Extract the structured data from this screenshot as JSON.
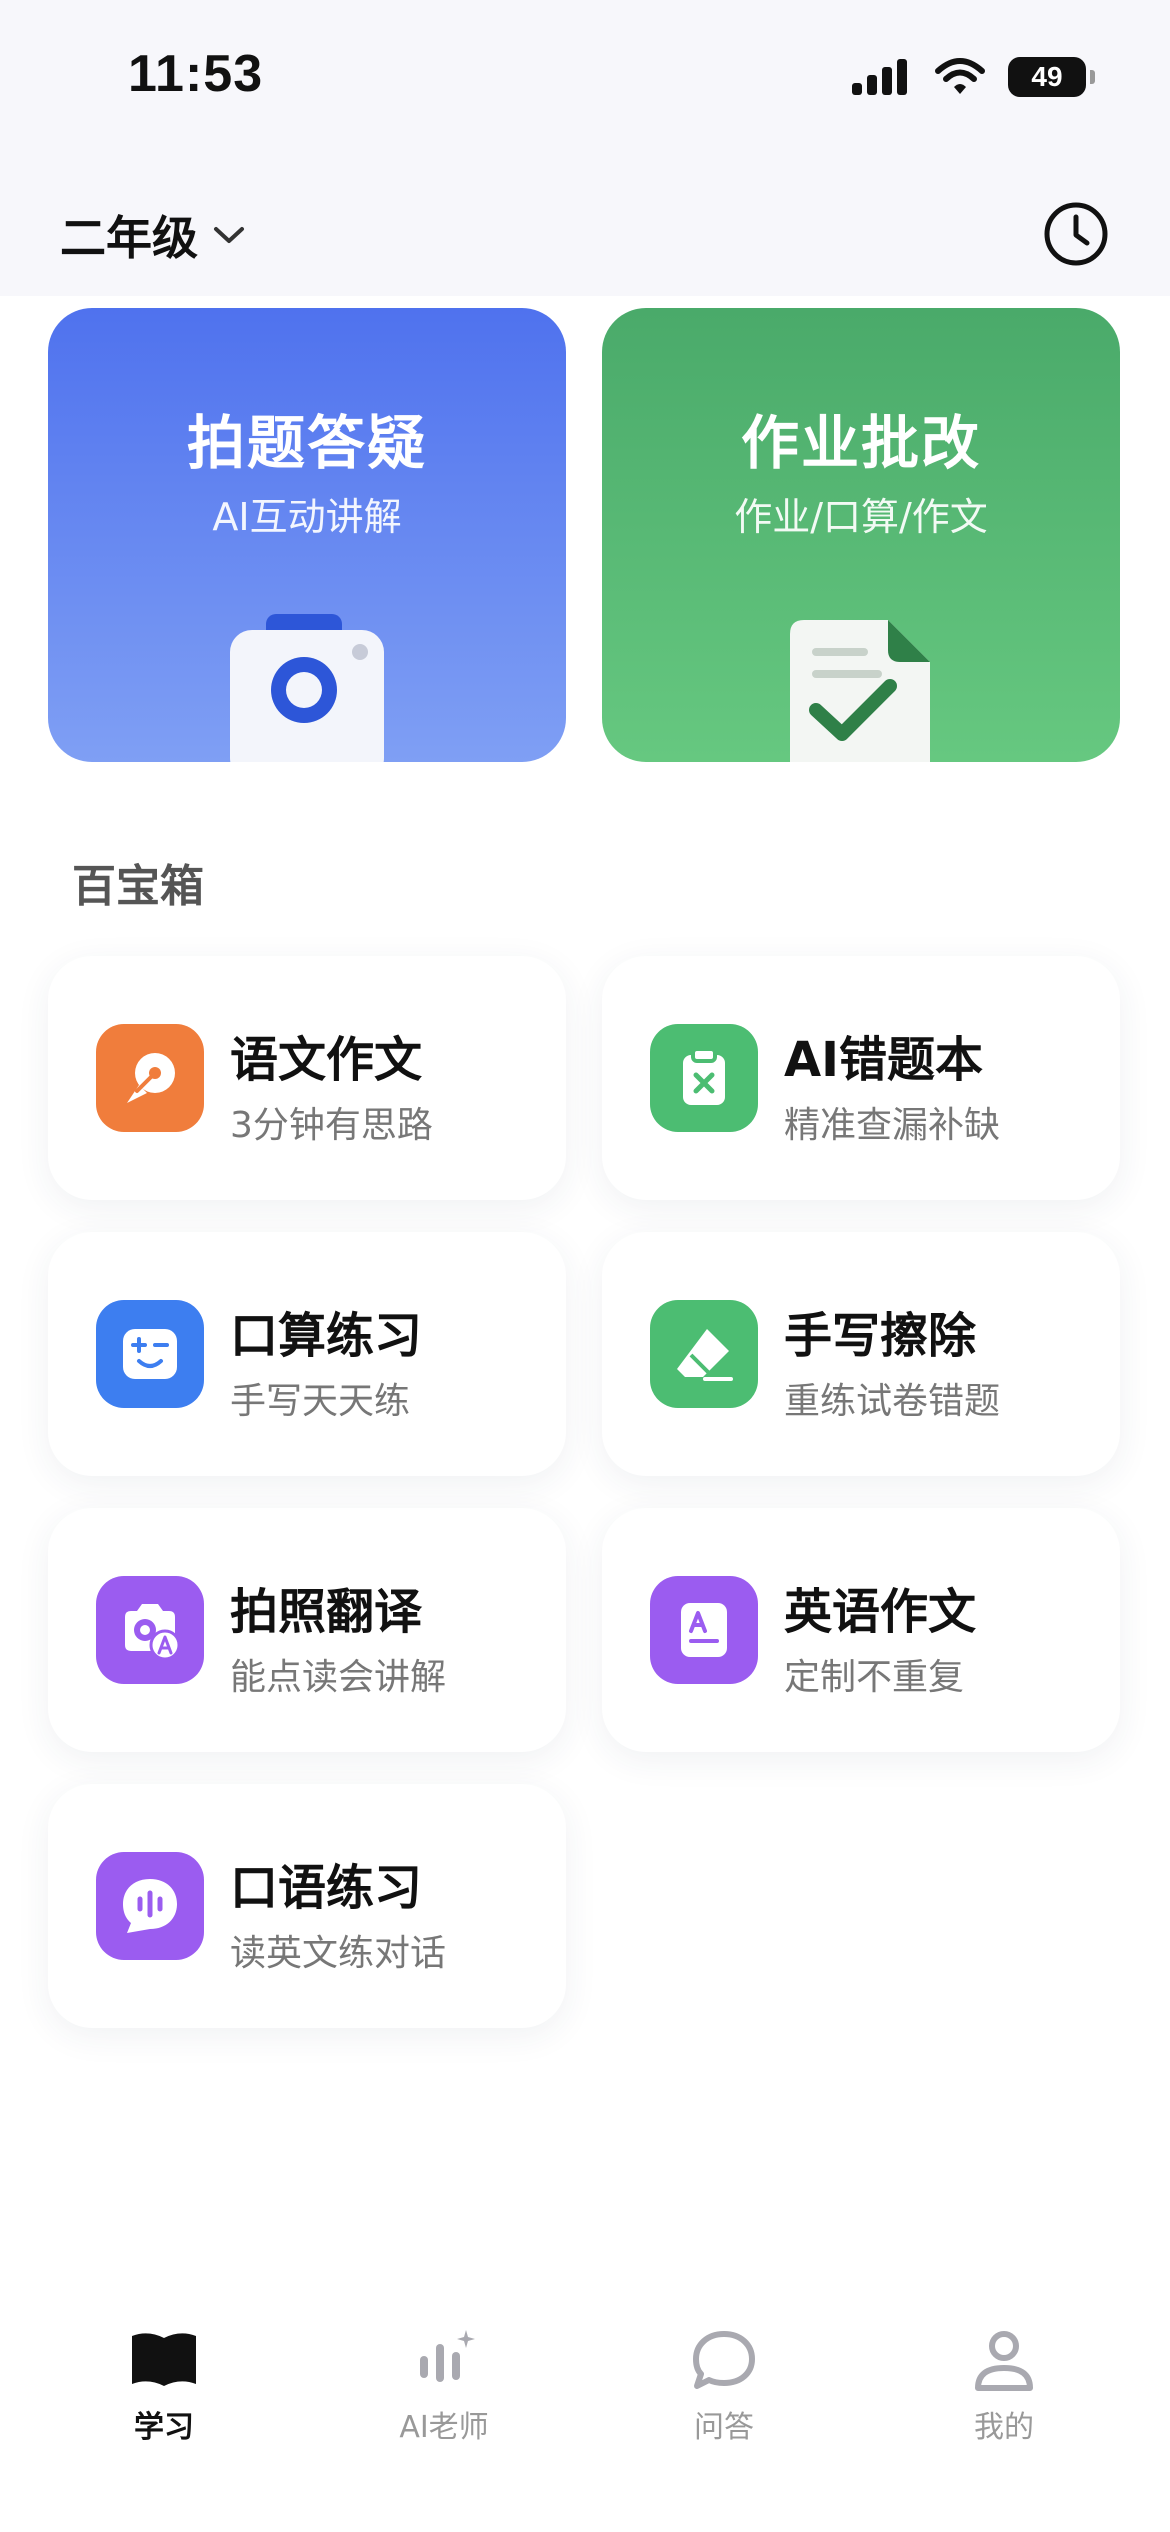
{
  "status_bar": {
    "time": "11:53",
    "battery": "49"
  },
  "header": {
    "grade": "二年级"
  },
  "hero_cards": [
    {
      "title": "拍题答疑",
      "subtitle": "AI互动讲解",
      "icon": "camera-icon",
      "color": "#4f72ee"
    },
    {
      "title": "作业批改",
      "subtitle": "作业/口算/作文",
      "icon": "document-check-icon",
      "color": "#4aaa6a"
    }
  ],
  "toolbox": {
    "title": "百宝箱",
    "items": [
      {
        "title": "语文作文",
        "subtitle": "3分钟有思路",
        "icon": "pen-nib-icon",
        "color": "#f07d3c"
      },
      {
        "title": "AI错题本",
        "subtitle": "精准查漏补缺",
        "icon": "clipboard-x-icon",
        "color": "#4cbd72"
      },
      {
        "title": "口算练习",
        "subtitle": "手写天天练",
        "icon": "math-face-icon",
        "color": "#3d7ef0"
      },
      {
        "title": "手写擦除",
        "subtitle": "重练试卷错题",
        "icon": "eraser-icon",
        "color": "#4cbd72"
      },
      {
        "title": "拍照翻译",
        "subtitle": "能点读会讲解",
        "icon": "camera-translate-icon",
        "color": "#9b5cf0"
      },
      {
        "title": "英语作文",
        "subtitle": "定制不重复",
        "icon": "letter-doc-icon",
        "color": "#9b5cf0"
      },
      {
        "title": "口语练习",
        "subtitle": "读英文练对话",
        "icon": "voice-chat-icon",
        "color": "#9b5cf0"
      }
    ]
  },
  "tab_bar": {
    "tabs": [
      {
        "label": "学习",
        "icon": "book-icon",
        "active": true
      },
      {
        "label": "AI老师",
        "icon": "ai-teacher-icon",
        "active": false
      },
      {
        "label": "问答",
        "icon": "chat-bubble-icon",
        "active": false
      },
      {
        "label": "我的",
        "icon": "user-icon",
        "active": false
      }
    ]
  }
}
